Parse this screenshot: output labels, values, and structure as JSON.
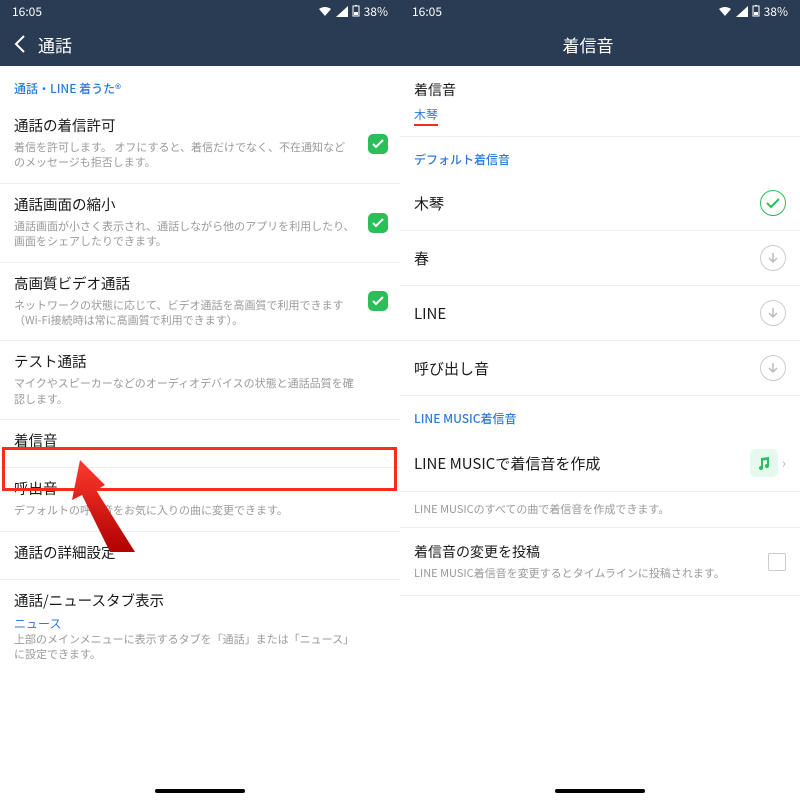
{
  "status": {
    "time": "16:05",
    "battery": "38%"
  },
  "left": {
    "title": "通話",
    "section": "通話・LINE 着うた®",
    "rows": [
      {
        "title": "通話の着信許可",
        "sub": "着信を許可します。\nオフにすると、着信だけでなく、不在通知などのメッセージも拒否します。",
        "toggle": true
      },
      {
        "title": "通話画面の縮小",
        "sub": "通話画面が小さく表示され、通話しながら他のアプリを利用したり、画面をシェアしたりできます。",
        "toggle": true
      },
      {
        "title": "高画質ビデオ通話",
        "sub": "ネットワークの状態に応じて、ビデオ通話を高画質で利用できます（Wi-Fi接続時は常に高画質で利用できます）。",
        "toggle": true
      },
      {
        "title": "テスト通話",
        "sub": "マイクやスピーカーなどのオーディオデバイスの状態と通話品質を確認します。"
      },
      {
        "title": "着信音"
      },
      {
        "title": "呼出音",
        "sub": "デフォルトの呼出音をお気に入りの曲に変更できます。"
      },
      {
        "title": "通話の詳細設定"
      },
      {
        "title": "通話/ニュースタブ表示",
        "value": "ニュース",
        "sub": "上部のメインメニューに表示するタブを「通話」または「ニュース」に設定できます。"
      }
    ]
  },
  "right": {
    "title": "着信音",
    "current": {
      "label": "着信音",
      "value": "木琴"
    },
    "default_section": "デフォルト着信音",
    "options": [
      {
        "label": "木琴",
        "selected": true
      },
      {
        "label": "春"
      },
      {
        "label": "LINE"
      },
      {
        "label": "呼び出し音"
      }
    ],
    "music_section": "LINE MUSIC着信音",
    "music_row": "LINE MUSICで着信音を作成",
    "music_note": "LINE MUSICのすべての曲で着信音を作成できます。",
    "post_row": "着信音の変更を投稿",
    "post_sub": "LINE MUSIC着信音を変更するとタイムラインに投稿されます。"
  }
}
